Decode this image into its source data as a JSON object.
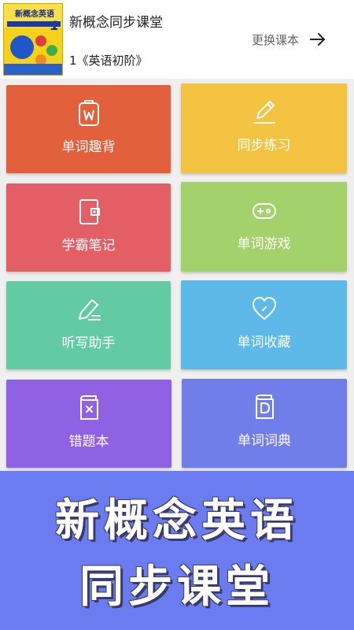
{
  "header": {
    "course_title": "新概念同步课堂",
    "course_subtitle": "1《英语初阶》",
    "change_label": "更换课本",
    "cover": {
      "title": "新概念英语",
      "number": "1",
      "english": "NEW CONCEPT ENGLISH"
    }
  },
  "tiles": [
    {
      "label": "单词趣背",
      "icon": "w-badge-icon",
      "color": "#e2603b"
    },
    {
      "label": "同步练习",
      "icon": "pencil-icon",
      "color": "#f3c341"
    },
    {
      "label": "学霸笔记",
      "icon": "notebook-icon",
      "color": "#e35f65"
    },
    {
      "label": "单词游戏",
      "icon": "gamepad-icon",
      "color": "#a3d16c"
    },
    {
      "label": "听写助手",
      "icon": "dictation-pen-icon",
      "color": "#63cba4"
    },
    {
      "label": "单词收藏",
      "icon": "heart-icon",
      "color": "#5cb9e8"
    },
    {
      "label": "错题本",
      "icon": "error-book-icon",
      "color": "#8f61e3"
    },
    {
      "label": "单词词典",
      "icon": "dictionary-icon",
      "color": "#6f7ee9"
    }
  ],
  "banner": {
    "line1": "新概念英语",
    "line2": "同步课堂",
    "color": "#6a7cef"
  }
}
